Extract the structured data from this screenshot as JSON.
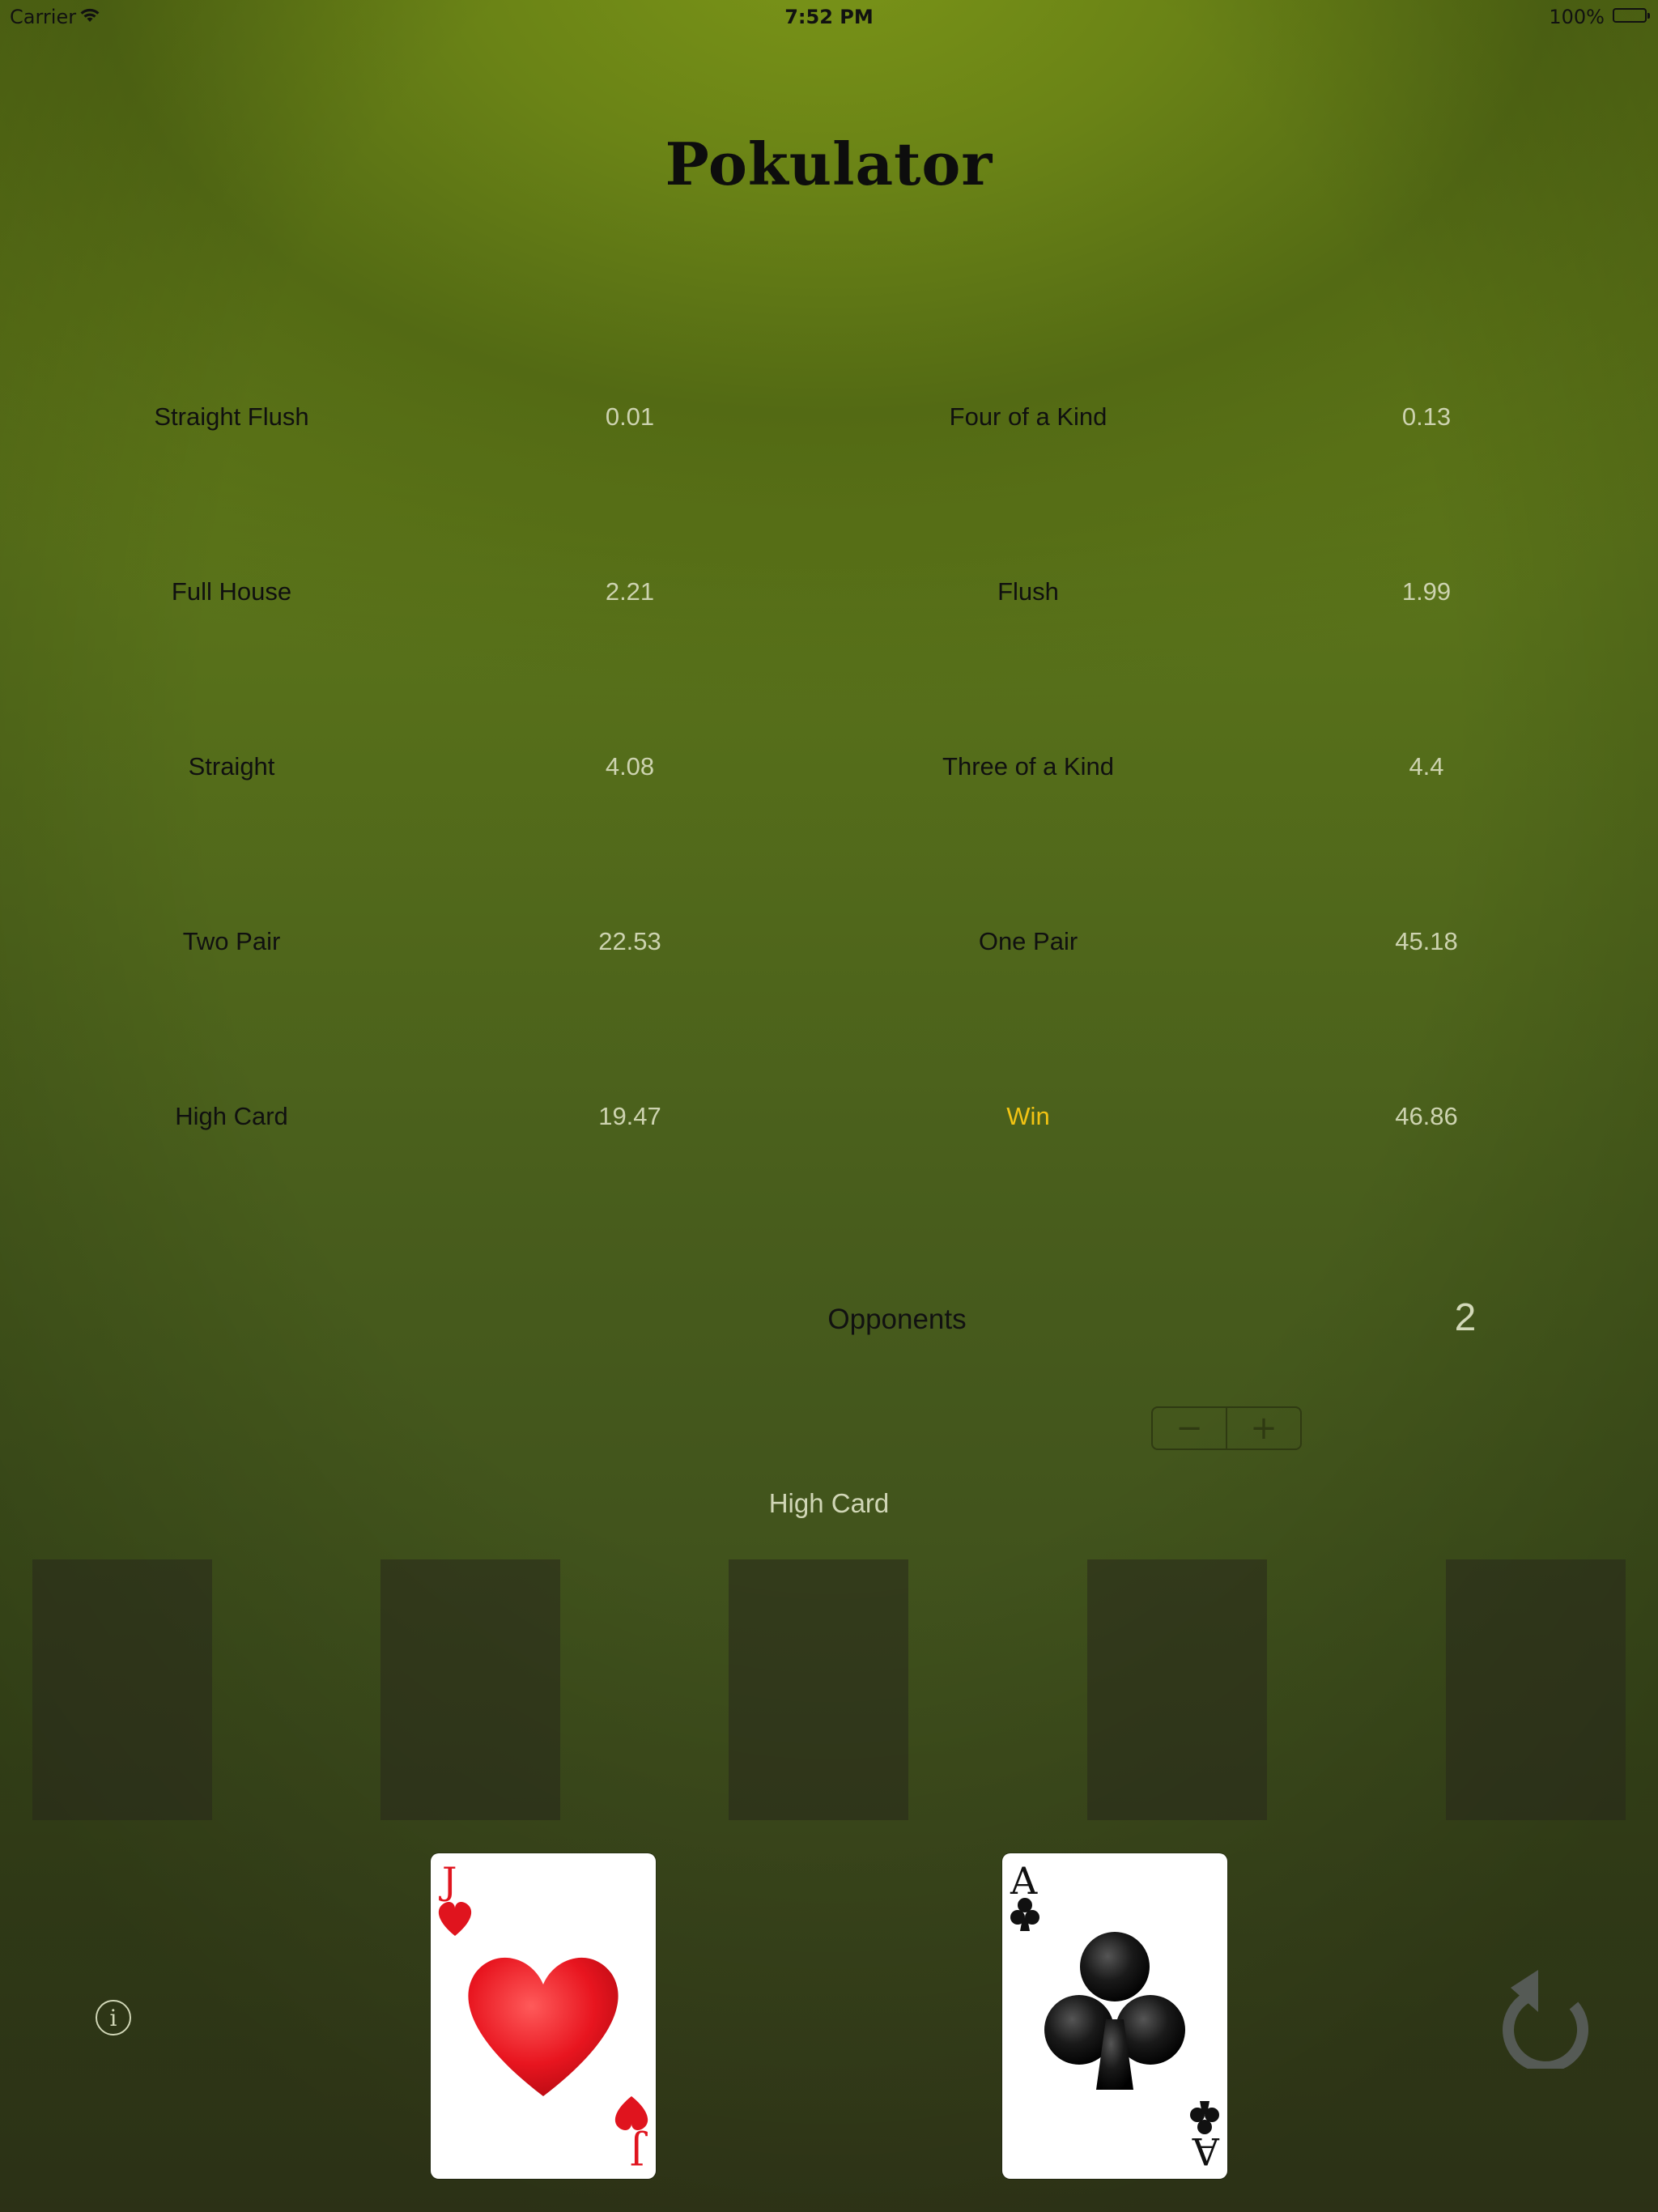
{
  "status_bar": {
    "carrier": "Carrier",
    "time": "7:52 PM",
    "battery": "100%"
  },
  "app": {
    "title": "Pokulator"
  },
  "stats": [
    {
      "label": "Straight Flush",
      "value": "0.01"
    },
    {
      "label": "Four of a Kind",
      "value": "0.13"
    },
    {
      "label": "Full House",
      "value": "2.21"
    },
    {
      "label": "Flush",
      "value": "1.99"
    },
    {
      "label": "Straight",
      "value": "4.08"
    },
    {
      "label": "Three of a Kind",
      "value": "4.4"
    },
    {
      "label": "Two Pair",
      "value": "22.53"
    },
    {
      "label": "One Pair",
      "value": "45.18"
    },
    {
      "label": "High Card",
      "value": "19.47"
    },
    {
      "label": "Win",
      "value": "46.86"
    }
  ],
  "opponents": {
    "label": "Opponents",
    "value": "2",
    "minus": "−",
    "plus": "+"
  },
  "current_hand": "High Card",
  "board_slots": 5,
  "hole_cards": [
    {
      "rank": "J",
      "suit": "hearts",
      "color": "#e0141e"
    },
    {
      "rank": "A",
      "suit": "clubs",
      "color": "#111111"
    }
  ],
  "colors": {
    "win_label": "#f2c313",
    "value_text": "#cdd3b0"
  },
  "icons": {
    "info": "info-icon",
    "reset": "reset-icon",
    "wifi": "wifi-icon",
    "battery": "battery-icon"
  }
}
